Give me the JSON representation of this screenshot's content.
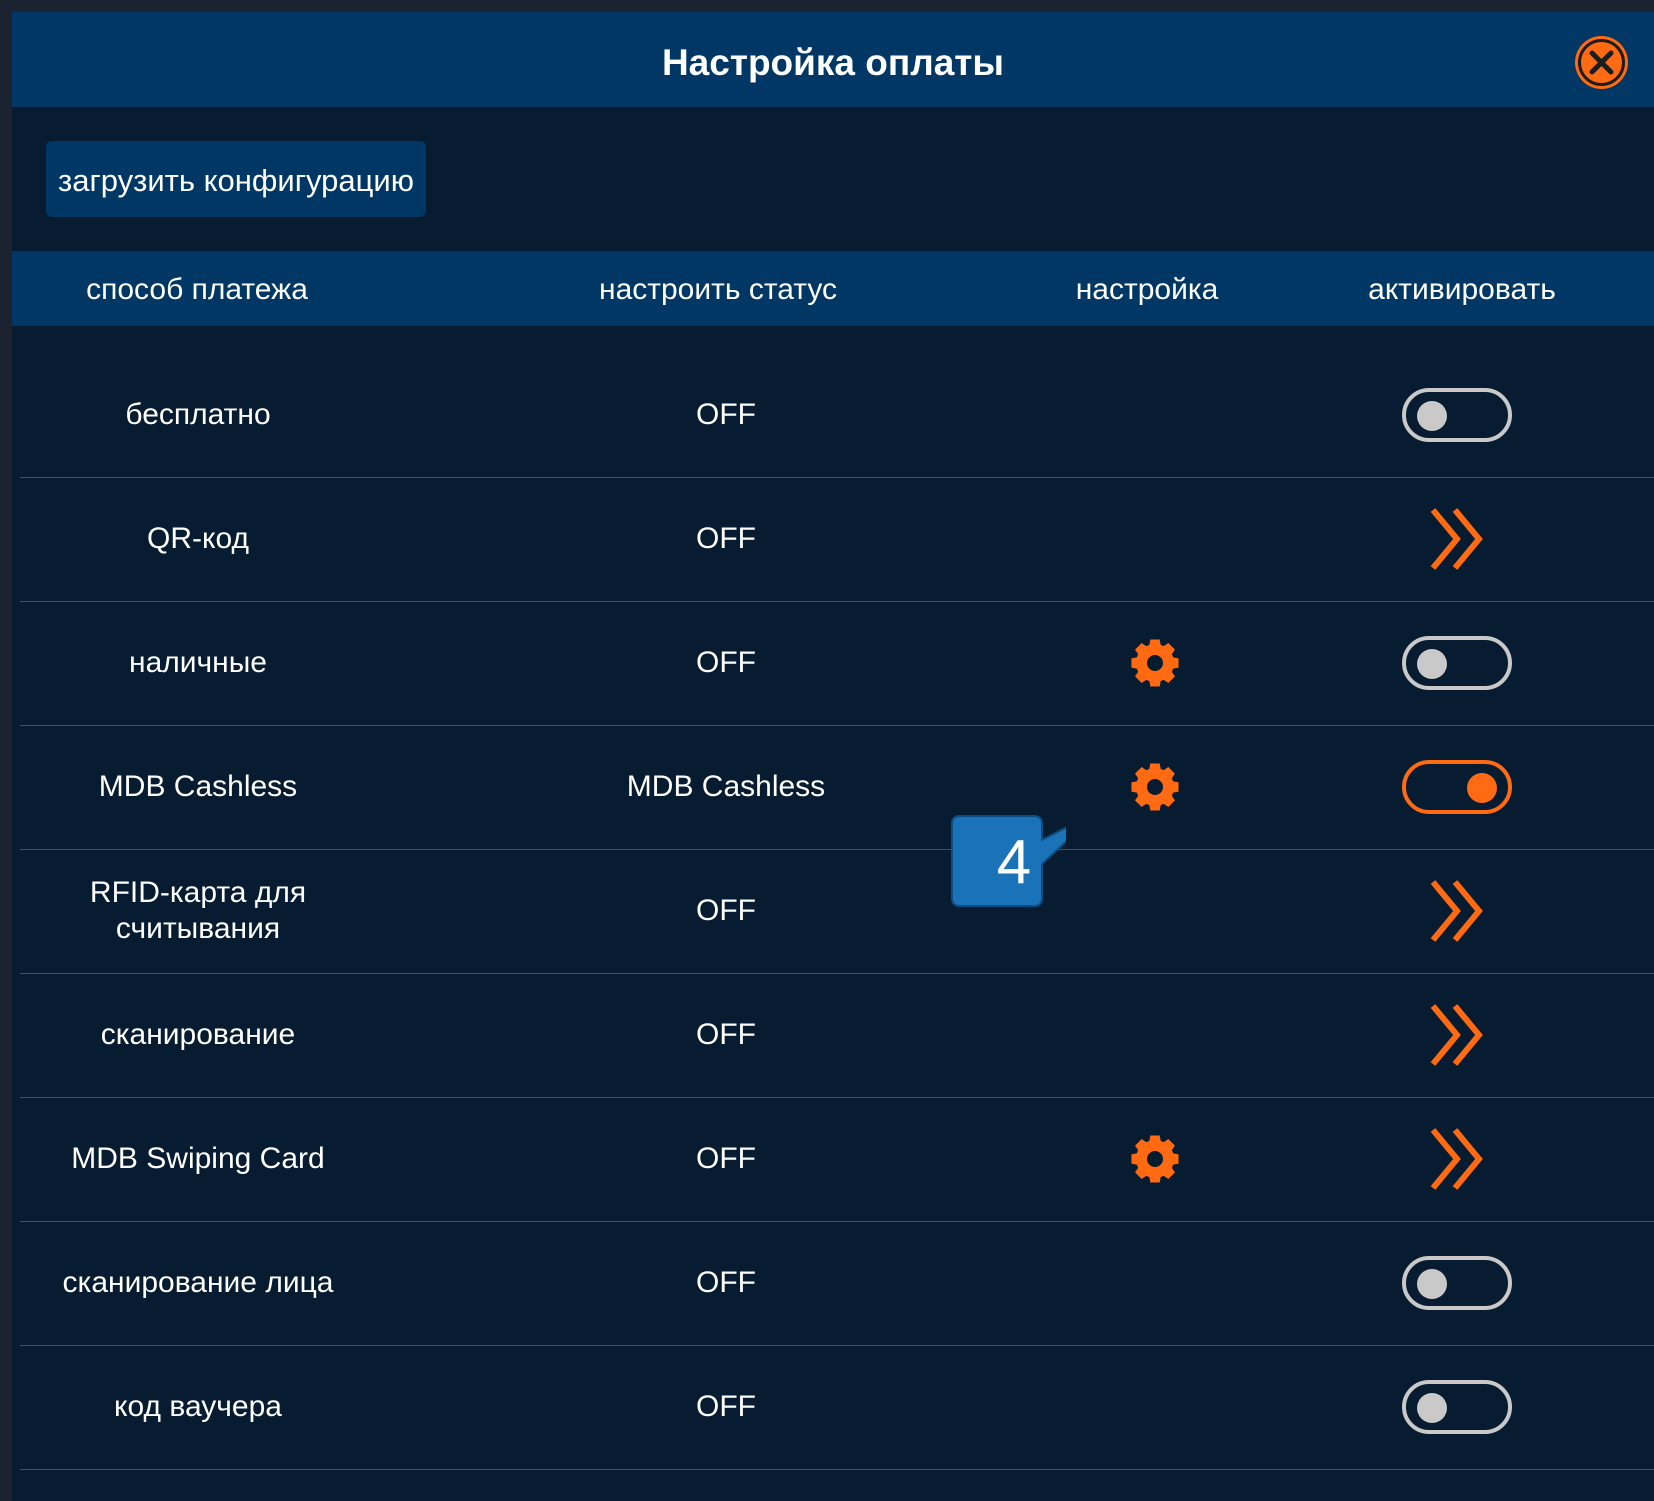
{
  "dialog": {
    "title": "Настройка оплаты",
    "close_icon": "close-icon"
  },
  "toolbar": {
    "load_config_label": "загрузить конфигурацию"
  },
  "table": {
    "headers": {
      "method": "способ платежа",
      "status": "настроить статус",
      "settings": "настройка",
      "activate": "активировать"
    },
    "rows": [
      {
        "method": "бесплатно",
        "status": "OFF",
        "has_settings": false,
        "activate_control": "toggle",
        "active": false
      },
      {
        "method": "QR-код",
        "status": "OFF",
        "has_settings": false,
        "activate_control": "chevron",
        "active": false
      },
      {
        "method": "наличные",
        "status": "OFF",
        "has_settings": true,
        "activate_control": "toggle",
        "active": false
      },
      {
        "method": "MDB Cashless",
        "status": "MDB Cashless",
        "has_settings": true,
        "activate_control": "toggle",
        "active": true
      },
      {
        "method": "RFID-карта для считывания",
        "status": "OFF",
        "has_settings": false,
        "activate_control": "chevron",
        "active": false
      },
      {
        "method": "сканирование",
        "status": "OFF",
        "has_settings": false,
        "activate_control": "chevron",
        "active": false
      },
      {
        "method": "MDB Swiping Card",
        "status": "OFF",
        "has_settings": true,
        "activate_control": "chevron",
        "active": false
      },
      {
        "method": "сканирование лица",
        "status": "OFF",
        "has_settings": false,
        "activate_control": "toggle",
        "active": false
      },
      {
        "method": "код ваучера",
        "status": "OFF",
        "has_settings": false,
        "activate_control": "toggle",
        "active": false
      }
    ]
  },
  "annotation": {
    "callout_number": "4"
  },
  "colors": {
    "accent": "#ff6a13",
    "header_bg": "#003764",
    "body_bg": "#071c30",
    "callout": "#1a73b8"
  }
}
